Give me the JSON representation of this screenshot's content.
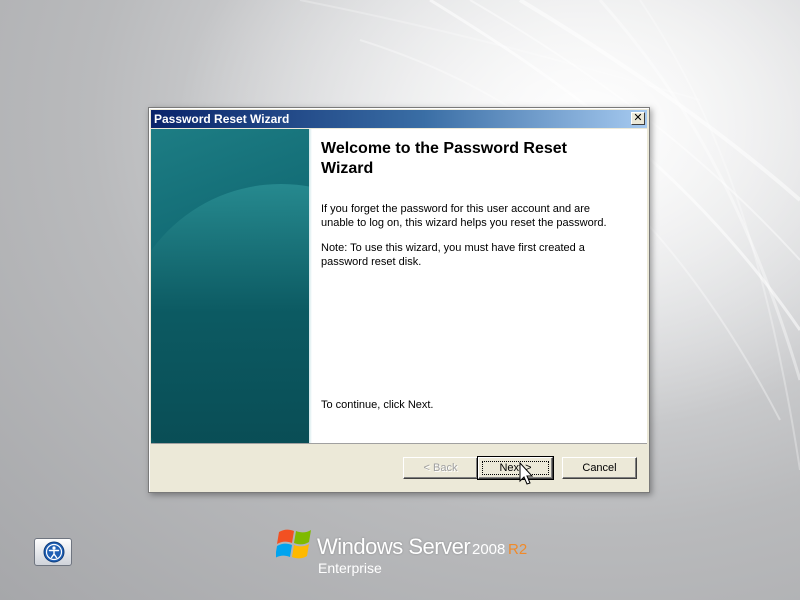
{
  "dialog": {
    "title": "Password Reset Wizard",
    "close_glyph": "✕",
    "heading": "Welcome to the Password Reset Wizard",
    "paragraph1": "If you forget the password for this user account and are unable to log on, this wizard helps you reset the password.",
    "paragraph2": "Note: To use this wizard, you must have first created a password reset disk.",
    "continue_text": "To continue, click Next.",
    "buttons": {
      "back": "< Back",
      "next": "Next >",
      "cancel": "Cancel"
    }
  },
  "branding": {
    "name": "Windows Server",
    "version": "2008",
    "release": "R2",
    "edition": "Enterprise"
  },
  "icons": {
    "close": "close-icon",
    "ease_of_access": "ease-of-access-icon",
    "logo": "windows-flag-icon",
    "cursor": "mouse-pointer-icon"
  },
  "colors": {
    "title_bar_start": "#0a246a",
    "title_bar_end": "#a6caf0",
    "banner": "#0f6670",
    "release_accent": "#f08a2a"
  }
}
